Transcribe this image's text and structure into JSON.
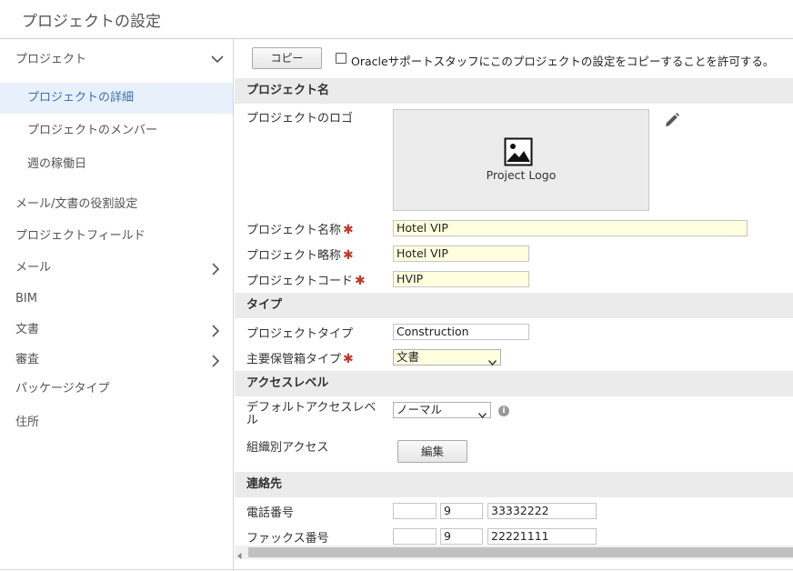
{
  "header": {
    "title": "プロジェクトの設定"
  },
  "sidebar": {
    "items": [
      {
        "label": "プロジェクト"
      },
      {
        "label": "プロジェクトの詳細"
      },
      {
        "label": "プロジェクトのメンバー"
      },
      {
        "label": "週の稼働日"
      },
      {
        "label": "メール/文書の役割設定"
      },
      {
        "label": "プロジェクトフィールド"
      },
      {
        "label": "メール"
      },
      {
        "label": "BIM"
      },
      {
        "label": "文書"
      },
      {
        "label": "審査"
      },
      {
        "label": "パッケージタイプ"
      },
      {
        "label": "住所"
      }
    ]
  },
  "toolbar": {
    "copy_label": "コピー",
    "allow_copy_label": "Oracleサポートスタッフにこのプロジェクトの設定をコピーすることを許可する。"
  },
  "sections": {
    "project_name": "プロジェクト名",
    "type": "タイプ",
    "access_level": "アクセスレベル",
    "contact": "連絡先"
  },
  "form": {
    "logo_label": "プロジェクトのロゴ",
    "logo_text": "Project Logo",
    "project_name_label": "プロジェクト名称",
    "project_name_value": "Hotel VIP",
    "project_short_label": "プロジェクト略称",
    "project_short_value": "Hotel VIP",
    "project_code_label": "プロジェクトコード",
    "project_code_value": "HVIP",
    "project_type_label": "プロジェクトタイプ",
    "project_type_value": "Construction",
    "primary_container_label": "主要保管箱タイプ",
    "primary_container_value": "文書",
    "default_access_label": "デフォルトアクセスレベル",
    "default_access_value": "ノーマル",
    "org_access_label": "組織別アクセス",
    "edit_label": "編集",
    "phone_label": "電話番号",
    "phone": [
      "",
      "9",
      "33332222"
    ],
    "fax_label": "ファックス番号",
    "fax": [
      "",
      "9",
      "22221111"
    ]
  },
  "colors": {
    "active_bg": "#e8f0fb",
    "active_text": "#3a6fb5",
    "required_bg": "#ffffdf",
    "required_mark": "#c0392b"
  }
}
